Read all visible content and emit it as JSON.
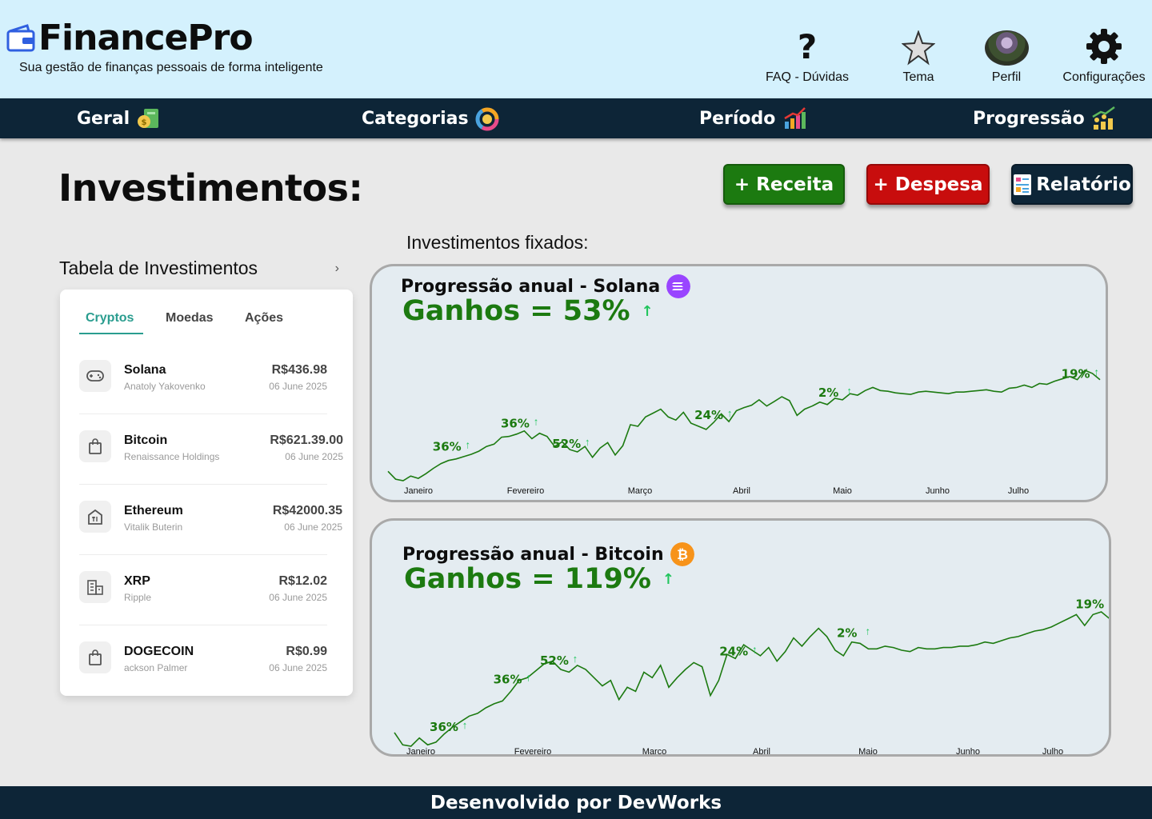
{
  "header": {
    "logo": "FinancePro",
    "tagline": "Sua gestão de finanças pessoais de forma inteligente",
    "items": [
      {
        "label": "FAQ - Dúvidas",
        "icon": "question-icon"
      },
      {
        "label": "Tema",
        "icon": "star-icon"
      },
      {
        "label": "Perfil",
        "icon": "avatar"
      },
      {
        "label": "Configurações",
        "icon": "gear-icon"
      }
    ]
  },
  "nav": {
    "items": [
      {
        "label": "Geral",
        "icon": "money-icon"
      },
      {
        "label": "Categorias",
        "icon": "pie-chart-icon"
      },
      {
        "label": "Período",
        "icon": "bar-chart-icon"
      },
      {
        "label": "Progressão",
        "icon": "growth-coins-icon"
      }
    ]
  },
  "page_title": "Investimentos:",
  "actions": {
    "receita": "+ Receita",
    "despesa": "+ Despesa",
    "relatorio": "Relatório"
  },
  "table": {
    "title": "Tabela de Investimentos",
    "tabs": [
      "Cryptos",
      "Moedas",
      "Ações"
    ],
    "active_tab": "Cryptos",
    "rows": [
      {
        "name": "Solana",
        "sub": "Anatoly Yakovenko",
        "value": "R$436.98",
        "date": "06 June 2025",
        "icon": "gamepad-icon"
      },
      {
        "name": "Bitcoin",
        "sub": "Renaissance Holdings",
        "value": "R$621.39.00",
        "date": "06 June 2025",
        "icon": "shopping-bag-icon"
      },
      {
        "name": "Ethereum",
        "sub": "Vitalik Buterin",
        "value": "R$42000.35",
        "date": "06 June 2025",
        "icon": "restaurant-icon"
      },
      {
        "name": "XRP",
        "sub": "Ripple",
        "value": "R$12.02",
        "date": "06 June 2025",
        "icon": "building-icon"
      },
      {
        "name": "DOGECOIN",
        "sub": "ackson Palmer",
        "value": "R$0.99",
        "date": "06 June 2025",
        "icon": "shopping-bag-icon"
      }
    ]
  },
  "fixados_label": "Investimentos fixados:",
  "charts": [
    {
      "title": "Progressão anual - Solana",
      "gain": "Ganhos = 53%",
      "coin_icon": "solana-icon",
      "coin_color": "#9945ff",
      "chart_data": {
        "type": "line",
        "x_labels": [
          "Janeiro",
          "Fevereiro",
          "Março",
          "Abril",
          "Maio",
          "Junho",
          "Julho"
        ],
        "annotations": [
          "36%",
          "36%",
          "52%",
          "24%",
          "2%",
          "19%"
        ],
        "trend": [
          12,
          2,
          0,
          6,
          3,
          9,
          16,
          22,
          26,
          28,
          31,
          34,
          38,
          44,
          47,
          56,
          57,
          60,
          64,
          54,
          61,
          57,
          44,
          50,
          40,
          37,
          44,
          30,
          42,
          49,
          33,
          45,
          72,
          70,
          82,
          87,
          92,
          82,
          78,
          88,
          74,
          70,
          66,
          75,
          86,
          76,
          90,
          94,
          97,
          104,
          96,
          102,
          108,
          103,
          84,
          92,
          96,
          101,
          98,
          106,
          104,
          112,
          110,
          116,
          120,
          116,
          115,
          113,
          112,
          111,
          114,
          115,
          114,
          113,
          112,
          114,
          114,
          115,
          116,
          117,
          115,
          114,
          119,
          120,
          123,
          120,
          125,
          124,
          128,
          131,
          134,
          130,
          142,
          138,
          130
        ],
        "series_color": "#1c7a10"
      }
    },
    {
      "title": "Progressão anual - Bitcoin",
      "gain": "Ganhos = 119%",
      "coin_icon": "bitcoin-icon",
      "coin_color": "#f7931a",
      "chart_data": {
        "type": "line",
        "x_labels": [
          "Janeiro",
          "Fevereiro",
          "Março",
          "Abril",
          "Maio",
          "Junho",
          "Julho"
        ],
        "annotations": [
          "36%",
          "36%",
          "52%",
          "24%",
          "2%",
          "19%"
        ],
        "trend": [
          20,
          2,
          0,
          12,
          2,
          6,
          18,
          28,
          36,
          44,
          48,
          56,
          62,
          66,
          80,
          96,
          100,
          110,
          120,
          124,
          112,
          108,
          118,
          112,
          100,
          88,
          96,
          68,
          86,
          80,
          108,
          100,
          118,
          86,
          100,
          112,
          122,
          116,
          74,
          96,
          134,
          128,
          148,
          140,
          132,
          144,
          124,
          138,
          158,
          146,
          160,
          172,
          160,
          140,
          132,
          152,
          150,
          142,
          142,
          146,
          144,
          140,
          138,
          144,
          142,
          142,
          144,
          144,
          146,
          146,
          148,
          152,
          150,
          154,
          158,
          160,
          164,
          168,
          170,
          174,
          180,
          186,
          192,
          176,
          192,
          196,
          186
        ],
        "series_color": "#1c7a10"
      }
    }
  ],
  "footer": "Desenvolvido por DevWorks"
}
